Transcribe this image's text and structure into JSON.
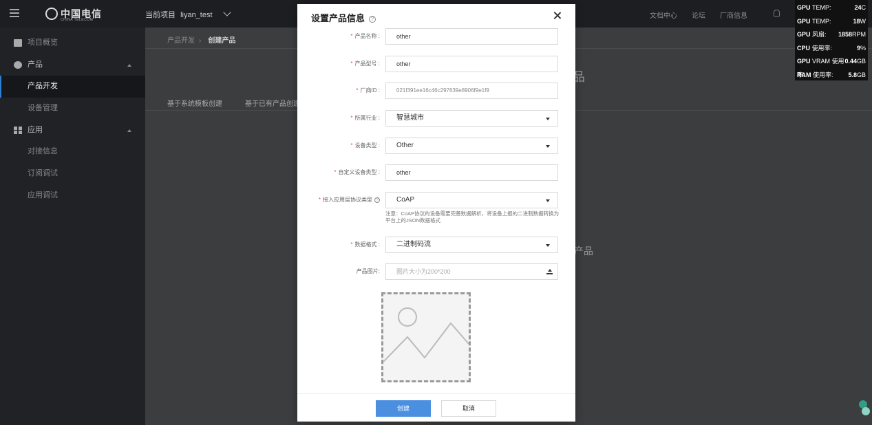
{
  "topbar": {
    "project_label": "当前项目",
    "project_name": "liyan_test",
    "logo_text": "中国电信",
    "logo_sub": "CHINA TELECOM",
    "links": [
      "文档中心",
      "论坛",
      "厂商信息"
    ]
  },
  "sidebar": {
    "items": [
      {
        "label": "项目概览"
      },
      {
        "label": "产品"
      },
      {
        "label": "产品开发"
      },
      {
        "label": "设备管理"
      },
      {
        "label": "应用"
      },
      {
        "label": "对接信息"
      },
      {
        "label": "订阅调试"
      },
      {
        "label": "应用调试"
      }
    ]
  },
  "content": {
    "breadcrumb": [
      "产品开发",
      "创建产品"
    ],
    "tabs": [
      "基于系统模板创建",
      "基于已有产品创建"
    ],
    "behind_text": "产品",
    "behind_title": "品"
  },
  "gpu_overlay": {
    "rows": [
      {
        "label": "GPU",
        "sub": "TEMP:",
        "value": "24",
        "unit": "C"
      },
      {
        "label": "GPU",
        "sub": "TEMP:",
        "value": "18",
        "unit": "W"
      },
      {
        "label": "GPU",
        "sub": "风扇:",
        "value": "1858",
        "unit": "RPM"
      },
      {
        "label": "CPU",
        "sub": "使用率:",
        "value": "9",
        "unit": "%"
      },
      {
        "label": "GPU",
        "sub": "VRAM 使用率:",
        "value": "0.44",
        "unit": "GB"
      },
      {
        "label": "RAM",
        "sub": "使用率:",
        "value": "5.8",
        "unit": "GB"
      }
    ]
  },
  "modal": {
    "title": "设置产品信息",
    "fields": {
      "product_name": {
        "label": "产品名称 :",
        "value": "other"
      },
      "product_model": {
        "label": "产品型号 :",
        "value": "other"
      },
      "vendor_id": {
        "label": "厂商ID :",
        "value": "021f391ee16c46c297639e8906f9e1f9"
      },
      "industry": {
        "label": "所属行业 :",
        "value": "智慧城市"
      },
      "device_type": {
        "label": "设备类型 :",
        "value": "Other"
      },
      "custom_device_type": {
        "label": "自定义设备类型 :",
        "value": "other"
      },
      "protocol": {
        "label": "接入应用层协议类型",
        "value": "CoAP"
      },
      "data_format": {
        "label": "数据格式 :",
        "value": "二进制码流"
      },
      "product_image": {
        "label": "产品图片:",
        "placeholder": "图片大小为200*200"
      }
    },
    "protocol_note": "注意：CoAP协议的设备需要完善数据解析，将设备上报的二进制数据转换为平台上的JSON数据格式",
    "buttons": {
      "create": "创建",
      "cancel": "取消"
    }
  }
}
